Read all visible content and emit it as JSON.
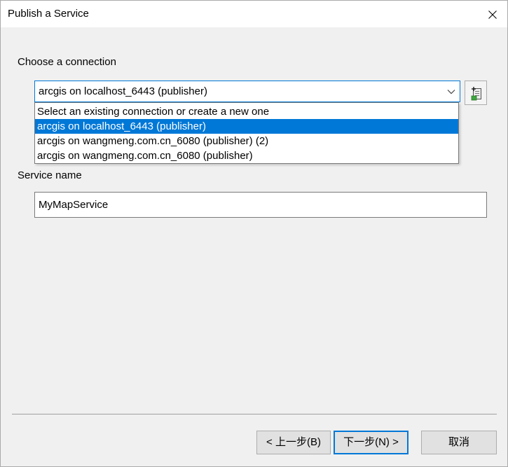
{
  "window": {
    "title": "Publish a Service"
  },
  "connection": {
    "label": "Choose a connection",
    "selected_value": "arcgis on localhost_6443 (publisher)",
    "options": [
      "Select an existing connection or create a new one",
      "arcgis on localhost_6443 (publisher)",
      "arcgis on wangmeng.com.cn_6080 (publisher) (2)",
      "arcgis on wangmeng.com.cn_6080 (publisher)"
    ],
    "highlighted_option": "arcgis on localhost_6443 (publisher)",
    "add_button_icon": "add-server-connection-icon"
  },
  "service": {
    "label": "Service name",
    "value": "MyMapService"
  },
  "buttons": {
    "back": "< 上一步(B)",
    "next": "下一步(N) >",
    "cancel": "取消"
  },
  "colors": {
    "accent": "#0078d7",
    "dialog_background": "#f0f0f0",
    "button_face": "#e1e1e1"
  }
}
